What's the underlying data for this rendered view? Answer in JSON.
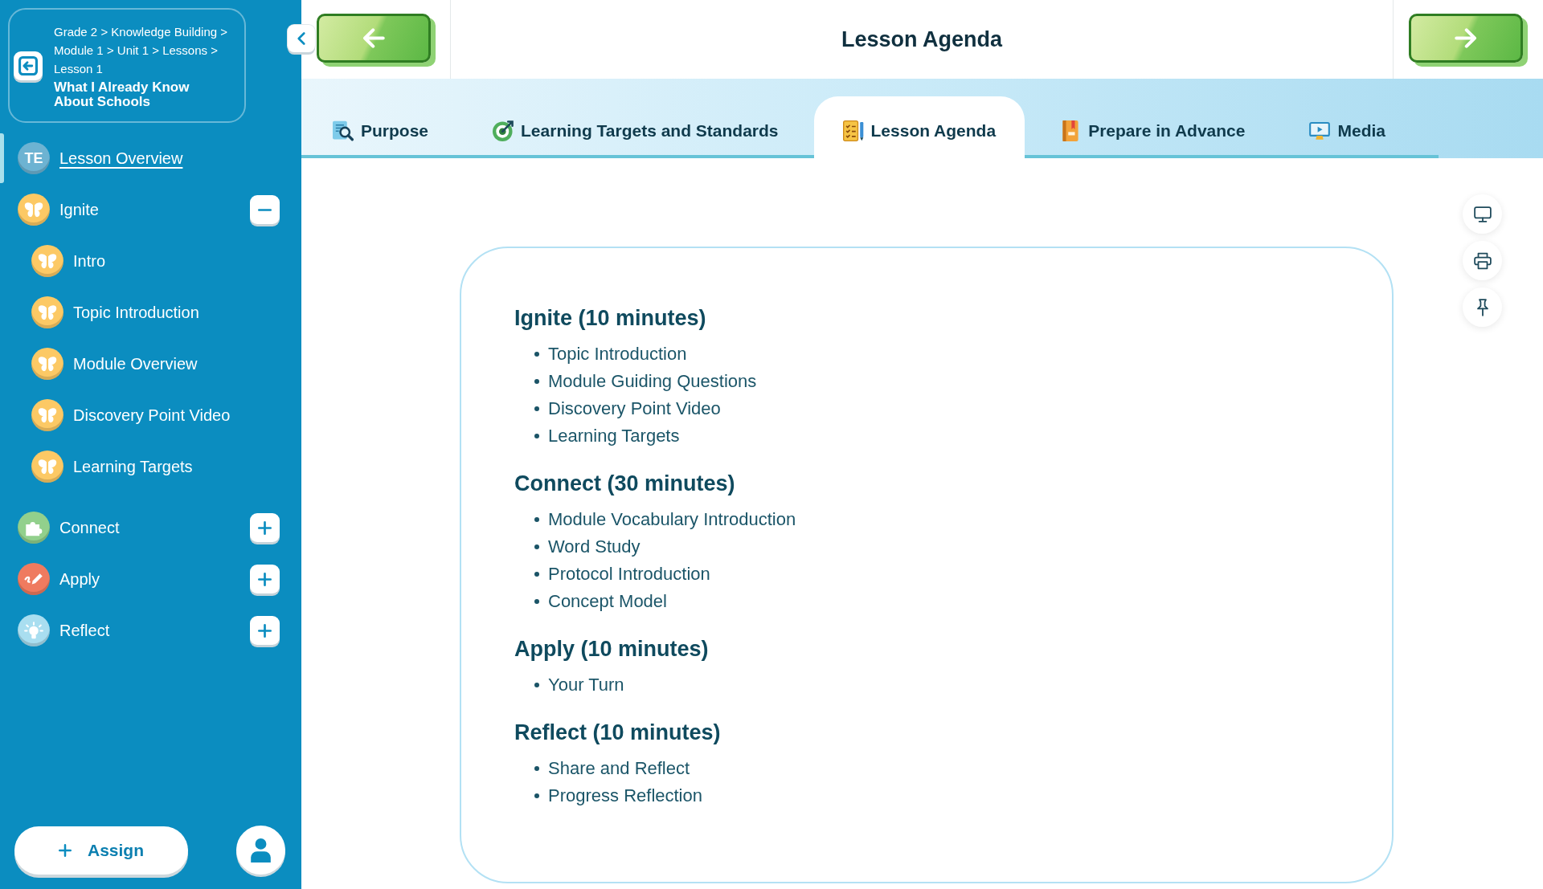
{
  "sidebar": {
    "breadcrumb": [
      {
        "label": "Grade 2",
        "separator": ">"
      },
      {
        "label": "Knowledge Building",
        "separator": ">"
      },
      {
        "label": "Module 1",
        "separator": ">"
      },
      {
        "label": "Unit 1",
        "separator": ">"
      },
      {
        "label": "Lessons",
        "separator": ">"
      },
      {
        "label": "Lesson 1"
      }
    ],
    "lesson_title": "What I Already Know About Schools",
    "nav": [
      {
        "kind": "overview",
        "badge": "TE",
        "label": "Lesson Overview",
        "selected": true
      },
      {
        "kind": "section",
        "label": "Ignite",
        "color": "#fcc965",
        "selected": false,
        "expanded": true,
        "children": [
          {
            "label": "Intro",
            "selected": false
          },
          {
            "label": "Topic Introduction",
            "selected": false
          },
          {
            "label": "Module Overview",
            "selected": false
          },
          {
            "label": "Discovery Point Video",
            "selected": false
          },
          {
            "label": "Learning Targets",
            "selected": false
          }
        ]
      },
      {
        "kind": "section",
        "label": "Connect",
        "color": "#92d08c",
        "selected": false,
        "expanded": false
      },
      {
        "kind": "section",
        "label": "Apply",
        "color": "#ef7b5f",
        "selected": false,
        "expanded": false
      },
      {
        "kind": "section",
        "label": "Reflect",
        "color": "#a9def0",
        "selected": false,
        "expanded": false
      }
    ],
    "assign_button": "Assign"
  },
  "header": {
    "title": "Lesson Agenda"
  },
  "tabs": [
    {
      "label": "Purpose",
      "selected": false
    },
    {
      "label": "Learning Targets and Standards",
      "selected": false
    },
    {
      "label": "Lesson Agenda",
      "selected": true
    },
    {
      "label": "Prepare in Advance",
      "selected": false
    },
    {
      "label": "Media",
      "selected": false
    }
  ],
  "agenda": [
    {
      "heading": "Ignite (10 minutes)",
      "items": [
        "Topic Introduction",
        "Module Guiding Questions",
        "Discovery Point Video",
        "Learning Targets"
      ]
    },
    {
      "heading": "Connect (30 minutes)",
      "items": [
        "Module Vocabulary Introduction",
        "Word Study",
        "Protocol Introduction",
        "Concept Model"
      ]
    },
    {
      "heading": "Apply (10 minutes)",
      "items": [
        "Your Turn"
      ]
    },
    {
      "heading": "Reflect (10 minutes)",
      "items": [
        "Share and Reflect",
        "Progress Reflection"
      ]
    }
  ]
}
